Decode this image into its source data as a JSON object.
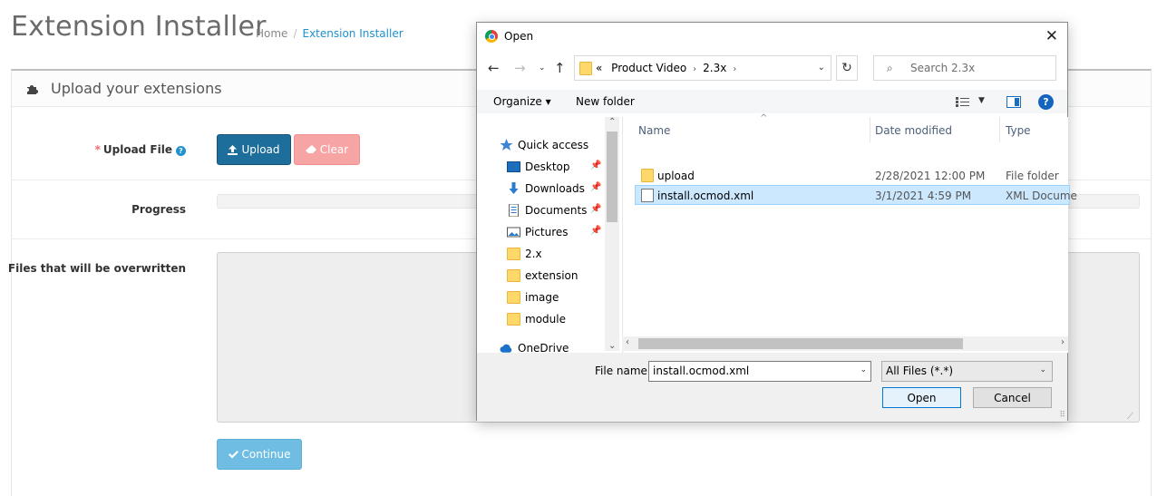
{
  "page": {
    "title": "Extension Installer",
    "breadcrumb": {
      "home": "Home",
      "separator": "/",
      "current": "Extension Installer"
    },
    "panel_title": "Upload your extensions",
    "upload_label": "Upload File",
    "required_mark": "*",
    "help_glyph": "?",
    "upload_button": "Upload",
    "clear_button": "Clear",
    "progress_label": "Progress",
    "progress_value": 0,
    "overwrite_label": "Files that will be overwritten",
    "continue_button": "Continue",
    "icons": {
      "panel": "puzzle-icon",
      "upload": "upload-icon",
      "clear": "eraser-icon",
      "continue": "check-icon"
    }
  },
  "dialog": {
    "title": "Open",
    "close_glyph": "✕",
    "address": {
      "overflow": "«",
      "path": [
        "Product Video",
        "2.3x"
      ]
    },
    "search_placeholder": "Search 2.3x",
    "toolbar": {
      "organize": "Organize ▾",
      "new_folder": "New folder"
    },
    "nav_items": [
      {
        "label": "Quick access",
        "icon": "star-icon",
        "pinned": false
      },
      {
        "label": "Desktop",
        "icon": "desktop-icon",
        "pinned": true
      },
      {
        "label": "Downloads",
        "icon": "download-icon",
        "pinned": true
      },
      {
        "label": "Documents",
        "icon": "documents-icon",
        "pinned": true
      },
      {
        "label": "Pictures",
        "icon": "pictures-icon",
        "pinned": true
      },
      {
        "label": "2.x",
        "icon": "folder-icon",
        "pinned": false
      },
      {
        "label": "extension",
        "icon": "folder-icon",
        "pinned": false
      },
      {
        "label": "image",
        "icon": "folder-icon",
        "pinned": false
      },
      {
        "label": "module",
        "icon": "folder-icon",
        "pinned": false
      },
      {
        "label": "OneDrive",
        "icon": "cloud-icon",
        "pinned": false
      }
    ],
    "columns": {
      "name": "Name",
      "date": "Date modified",
      "type": "Type"
    },
    "files": [
      {
        "name": "upload",
        "date": "2/28/2021 12:00 PM",
        "type": "File folder",
        "icon": "folder-icon",
        "selected": false
      },
      {
        "name": "install.ocmod.xml",
        "date": "3/1/2021 4:59 PM",
        "type": "XML Docume",
        "icon": "document-icon",
        "selected": true
      }
    ],
    "file_name_label": "File name:",
    "file_name_value": "install.ocmod.xml",
    "file_type_value": "All Files (*.*)",
    "open_button": "Open",
    "cancel_button": "Cancel"
  },
  "colors": {
    "accent": "#1e91cf",
    "upload_button": "#1e6e9b",
    "clear_button": "#f7a4a4",
    "continue_button": "#6fbde3",
    "selection": "#cce8ff",
    "folder": "#ffd86b"
  }
}
